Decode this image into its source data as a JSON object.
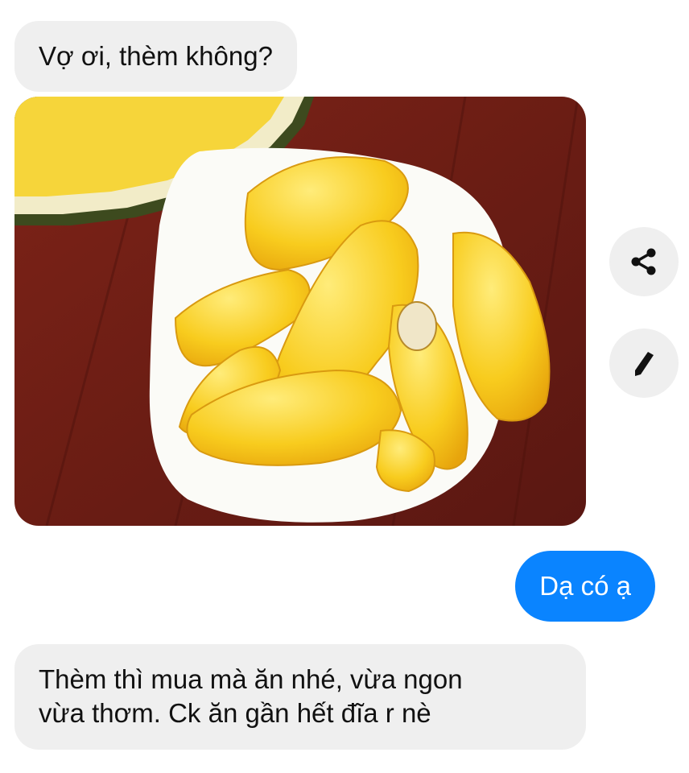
{
  "messages": [
    {
      "direction": "incoming",
      "text": "Vợ ơi, thèm không?"
    },
    {
      "direction": "incoming",
      "type": "image",
      "image_icon": "jackfruit-photo"
    },
    {
      "direction": "outgoing",
      "text": "Dạ có ạ"
    },
    {
      "direction": "incoming",
      "lines": [
        "Thèm thì mua mà ăn nhé, vừa ngon",
        "vừa thơm. Ck ăn gần hết đĩa r nè"
      ]
    }
  ],
  "actions": {
    "share_icon": "share-icon",
    "edit_icon": "pencil-icon"
  },
  "colors": {
    "incoming_bubble": "#efefef",
    "outgoing_bubble": "#0a84ff",
    "text": "#111111"
  }
}
